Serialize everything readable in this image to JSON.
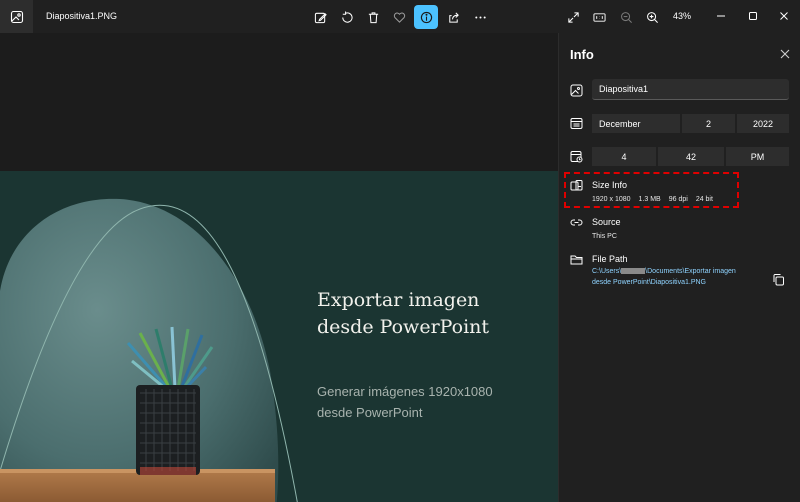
{
  "titlebar": {
    "file_name": "Diapositiva1.PNG",
    "zoom": "43%",
    "toolbar_icons": [
      "edit-image-icon",
      "rotate-icon",
      "delete-icon",
      "favorite-icon",
      "info-icon",
      "share-icon",
      "more-icon"
    ],
    "right_icons": [
      "fullscreen-icon",
      "actual-size-icon",
      "zoom-out-icon",
      "zoom-in-icon"
    ],
    "active_tool": "info-icon",
    "accent_color": "#4cc2ff"
  },
  "slide": {
    "title": "Exportar imagen\ndesde PowerPoint",
    "subtitle": "Generar imágenes 1920x1080\ndesde PowerPoint",
    "background_color": "#1b3532"
  },
  "info_panel": {
    "title": "Info",
    "name_value": "Diapositiva1",
    "date": {
      "month": "December",
      "day": "2",
      "year": "2022"
    },
    "time": {
      "hour": "4",
      "minute": "42",
      "period": "PM"
    },
    "size_info": {
      "label": "Size Info",
      "dimensions": "1920 x 1080",
      "file_size": "1.3 MB",
      "dpi": "96 dpi",
      "bit_depth": "24 bit"
    },
    "source": {
      "label": "Source",
      "value": "This PC"
    },
    "file_path": {
      "label": "File Path",
      "prefix": "C:\\Users\\",
      "suffix_line1": "\\Documents\\Exportar imagen",
      "line2": "desde PowerPoint\\Diapositiva1.PNG"
    },
    "highlight_color": "#e00000"
  }
}
